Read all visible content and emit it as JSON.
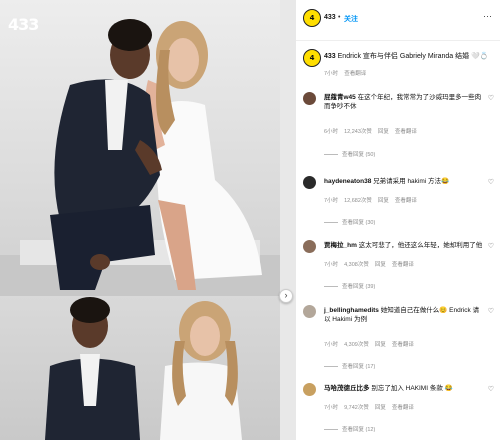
{
  "brand": {
    "logo_text": "433"
  },
  "media": {
    "next_glyph": "›"
  },
  "post": {
    "author": "433",
    "dot": "•",
    "follow_label": "关注",
    "more_glyph": "···",
    "avatar_text": "4",
    "caption": "Endrick 宣布与伴侣 Gabriely Miranda 结婚 🤍💍",
    "caption_time": "7小时",
    "caption_translate": "查看翻译"
  },
  "comments": [
    {
      "username": "屁蔻青w45",
      "text": "在这个年纪，我常常为了沙威玛里多一些肉而争吵不休",
      "time": "6小时",
      "likes": "12,243次赞",
      "reply": "回复",
      "translate": "查看翻译",
      "replies": "查看回复 (50)",
      "avatar_color": "#6b4a3a"
    },
    {
      "username": "haydeneaton38",
      "text": "兄弟请采用 hakimi 方法😂",
      "time": "7小时",
      "likes": "12,682次赞",
      "reply": "回复",
      "translate": "查看翻译",
      "replies": "查看回复 (30)",
      "avatar_color": "#2a2a2a"
    },
    {
      "username": "贾梅拉_hm",
      "text": "这太可悲了，他还这么年轻，她却利用了他",
      "time": "7小时",
      "likes": "4,308次赞",
      "reply": "回复",
      "translate": "查看翻译",
      "replies": "查看回复 (39)",
      "avatar_color": "#8a6d5a"
    },
    {
      "username": "j_bellinghamedits",
      "text": "她知道自己在做什么😊 Endrick 请以 Hakimi 为例",
      "time": "7小时",
      "likes": "4,309次赞",
      "reply": "回复",
      "translate": "查看翻译",
      "replies": "查看回复 (17)",
      "avatar_color": "#b3a79a"
    },
    {
      "username": "马哈茂德丘比多",
      "text": "别忘了加入 HAKIMI 条款 😂",
      "time": "7小时",
      "likes": "9,742次赞",
      "reply": "回复",
      "translate": "查看翻译",
      "replies": "查看回复 (12)",
      "avatar_color": "#c8a060"
    }
  ],
  "icons": {
    "heart": "♡"
  }
}
